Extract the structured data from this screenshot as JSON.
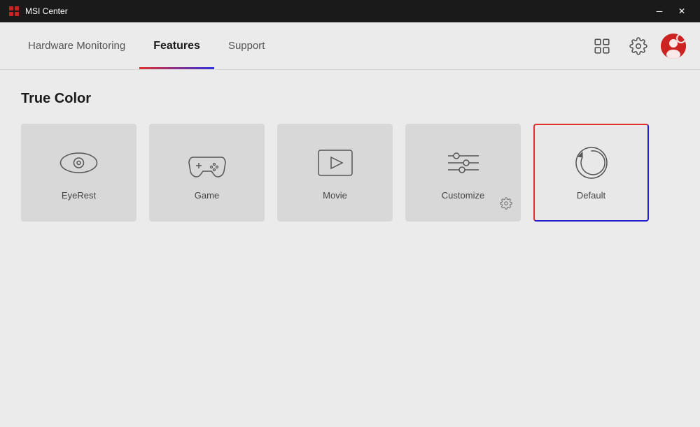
{
  "titleBar": {
    "title": "MSI Center",
    "minimizeLabel": "─",
    "closeLabel": "✕"
  },
  "nav": {
    "tabs": [
      {
        "id": "hardware-monitoring",
        "label": "Hardware Monitoring",
        "active": false
      },
      {
        "id": "features",
        "label": "Features",
        "active": true
      },
      {
        "id": "support",
        "label": "Support",
        "active": false
      }
    ],
    "gridIconTitle": "grid-view",
    "settingsIconTitle": "settings",
    "avatarTitle": "user-avatar"
  },
  "content": {
    "sectionTitle": "True Color",
    "cards": [
      {
        "id": "eyerest",
        "label": "EyeRest",
        "icon": "eye",
        "selected": false
      },
      {
        "id": "game",
        "label": "Game",
        "icon": "gamepad",
        "selected": false
      },
      {
        "id": "movie",
        "label": "Movie",
        "icon": "movie",
        "selected": false
      },
      {
        "id": "customize",
        "label": "Customize",
        "icon": "sliders",
        "selected": false,
        "hasGear": true
      },
      {
        "id": "default",
        "label": "Default",
        "icon": "refresh",
        "selected": true
      }
    ]
  }
}
